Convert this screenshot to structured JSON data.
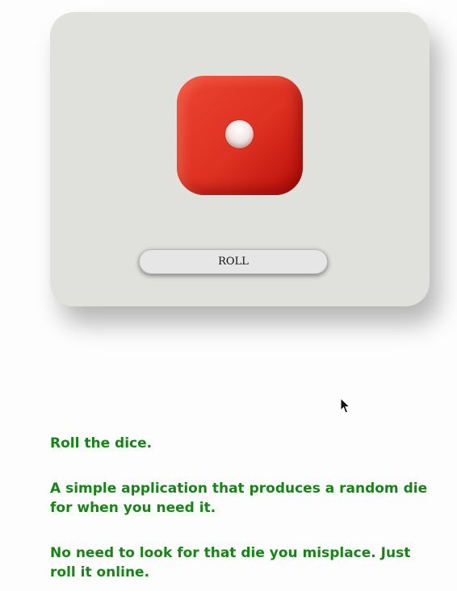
{
  "die": {
    "face_value": 1,
    "color": "#dd3122",
    "pip_color": "#f4eeed"
  },
  "roll_button": {
    "label": "ROLL"
  },
  "description": {
    "paragraphs": [
      "Roll the dice.",
      "A simple application that produces a random die for when you need it.",
      "No need to look for that die you misplace. Just roll it online."
    ],
    "color": "#168516"
  },
  "background": "#fdfdfd",
  "card_color": "#e0e0dd"
}
